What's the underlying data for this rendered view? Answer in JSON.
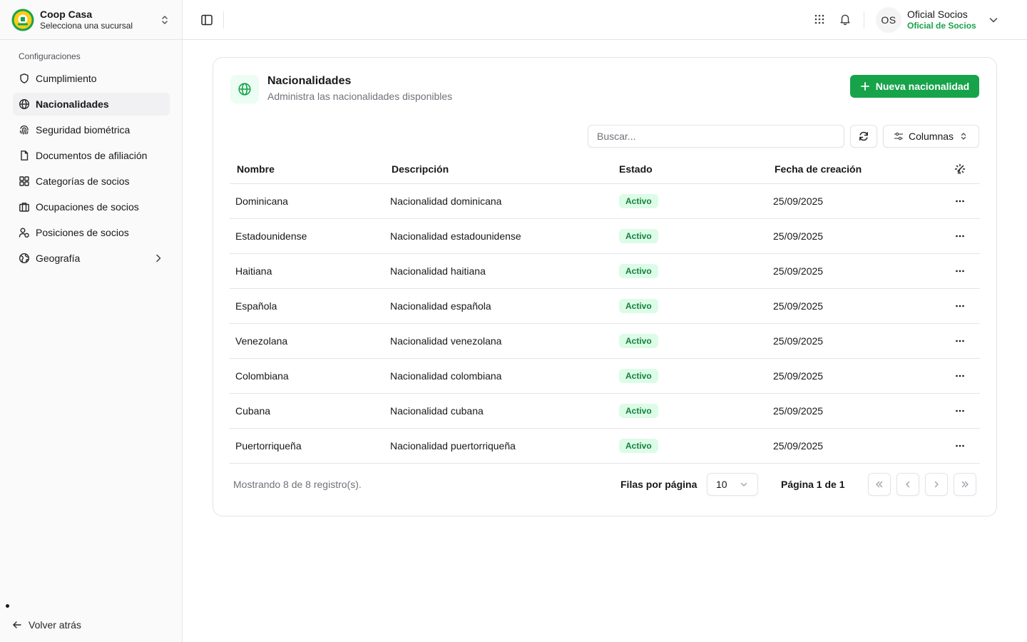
{
  "org": {
    "name": "Coop Casa",
    "subtitle": "Selecciona una sucursal",
    "logo_icon": "coop-logo"
  },
  "sidebar": {
    "group_label": "Configuraciones",
    "items": [
      {
        "label": "Cumplimiento",
        "icon": "shield-icon"
      },
      {
        "label": "Nacionalidades",
        "icon": "globe-icon",
        "active": true
      },
      {
        "label": "Seguridad biométrica",
        "icon": "fingerprint-icon"
      },
      {
        "label": "Documentos de afiliación",
        "icon": "file-icon"
      },
      {
        "label": "Categorías de socios",
        "icon": "grid-icon"
      },
      {
        "label": "Ocupaciones de socios",
        "icon": "briefcase-icon"
      },
      {
        "label": "Posiciones de socios",
        "icon": "users-icon"
      },
      {
        "label": "Geografía",
        "icon": "earth-icon",
        "has_submenu": true
      }
    ],
    "back_label": "Volver atrás"
  },
  "header": {
    "user": {
      "initials": "OS",
      "name": "Oficial Socios",
      "role": "Oficial de Socios"
    }
  },
  "page": {
    "title": "Nacionalidades",
    "subtitle": "Administra las nacionalidades disponibles",
    "new_button": "Nueva nacionalidad",
    "search_placeholder": "Buscar...",
    "columns_button": "Columnas"
  },
  "table": {
    "headers": {
      "name": "Nombre",
      "description": "Descripción",
      "status": "Estado",
      "created": "Fecha de creación"
    },
    "rows": [
      {
        "name": "Dominicana",
        "description": "Nacionalidad dominicana",
        "status": "Activo",
        "created": "25/09/2025"
      },
      {
        "name": "Estadounidense",
        "description": "Nacionalidad estadounidense",
        "status": "Activo",
        "created": "25/09/2025"
      },
      {
        "name": "Haitiana",
        "description": "Nacionalidad haitiana",
        "status": "Activo",
        "created": "25/09/2025"
      },
      {
        "name": "Española",
        "description": "Nacionalidad española",
        "status": "Activo",
        "created": "25/09/2025"
      },
      {
        "name": "Venezolana",
        "description": "Nacionalidad venezolana",
        "status": "Activo",
        "created": "25/09/2025"
      },
      {
        "name": "Colombiana",
        "description": "Nacionalidad colombiana",
        "status": "Activo",
        "created": "25/09/2025"
      },
      {
        "name": "Cubana",
        "description": "Nacionalidad cubana",
        "status": "Activo",
        "created": "25/09/2025"
      },
      {
        "name": "Puertorriqueña",
        "description": "Nacionalidad puertorriqueña",
        "status": "Activo",
        "created": "25/09/2025"
      }
    ]
  },
  "pagination": {
    "showing": "Mostrando 8 de 8 registro(s).",
    "rows_label": "Filas por página",
    "rows_value": "10",
    "page_label": "Página 1 de 1"
  },
  "colors": {
    "accent": "#16a34a",
    "badge_bg": "#dcfce7",
    "badge_text": "#15803d",
    "border": "#e4e4e7"
  }
}
